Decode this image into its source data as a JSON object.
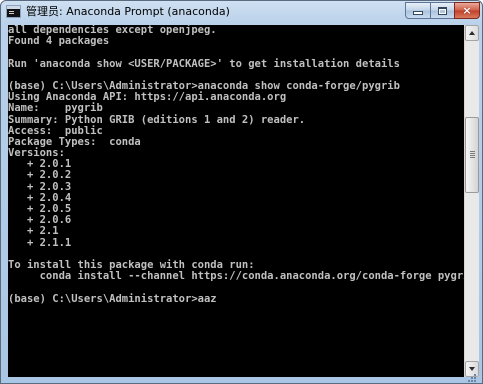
{
  "window": {
    "title": "管理员: Anaconda Prompt (anaconda)",
    "controls": {
      "minimize": "minimize",
      "maximize": "maximize",
      "close": "×"
    }
  },
  "console": {
    "background": "#000000",
    "foreground": "#c0c0c0",
    "lines": [
      "all dependencies except openjpeg.",
      "Found 4 packages",
      "",
      "Run 'anaconda show <USER/PACKAGE>' to get installation details",
      "",
      "(base) C:\\Users\\Administrator>anaconda show conda-forge/pygrib",
      "Using Anaconda API: https://api.anaconda.org",
      "Name:    pygrib",
      "Summary: Python GRIB (editions 1 and 2) reader.",
      "Access:  public",
      "Package Types:  conda",
      "Versions:",
      "   + 2.0.1",
      "   + 2.0.2",
      "   + 2.0.3",
      "   + 2.0.4",
      "   + 2.0.5",
      "   + 2.0.6",
      "   + 2.1",
      "   + 2.1.1",
      "",
      "To install this package with conda run:",
      "     conda install --channel https://conda.anaconda.org/conda-forge pygrib",
      "",
      "(base) C:\\Users\\Administrator>aaz"
    ]
  },
  "scrollbar": {
    "icons": [
      "scroll-up-arrow",
      "scroll-down-arrow"
    ]
  }
}
